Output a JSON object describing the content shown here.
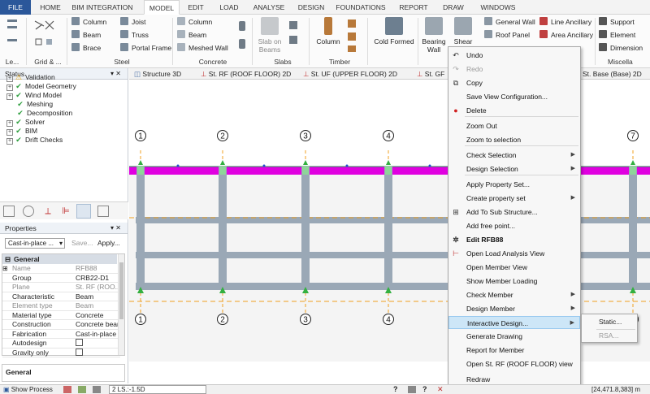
{
  "ribbon_tabs": [
    "FILE",
    "HOME",
    "BIM INTEGRATION",
    "MODEL",
    "EDIT",
    "LOAD",
    "ANALYSE",
    "DESIGN",
    "FOUNDATIONS",
    "REPORT",
    "DRAW",
    "WINDOWS"
  ],
  "ribbon": {
    "levels_label": "Le...",
    "grid_label": "Grid & ...",
    "steel": {
      "column": "Column",
      "beam": "Beam",
      "brace": "Brace",
      "joist": "Joist",
      "truss": "Truss",
      "portal_frame": "Portal Frame",
      "group": "Steel"
    },
    "concrete": {
      "column": "Column",
      "beam": "Beam",
      "meshed_wall": "Meshed Wall",
      "group": "Concrete"
    },
    "slabs": {
      "slab_on_beams": "Slab on Beams",
      "group": "Slabs"
    },
    "timber": {
      "column": "Column",
      "group": "Timber"
    },
    "cold_formed": {
      "label": "Cold Formed"
    },
    "bearing_wall": "Bearing Wall",
    "shear": "Shear",
    "general_wall": "General Wall",
    "roof_panel": "Roof Panel",
    "line_ancillary": "Line Ancillary",
    "area_ancillary": "Area Ancillary",
    "support": "Support",
    "element": "Element",
    "dimension": "Dimension",
    "misc_group": "Miscella"
  },
  "status_panel": {
    "title": "Status",
    "items": [
      {
        "label": "Validation",
        "icon": "warning-icon",
        "state": "warning"
      },
      {
        "label": "Model Geometry",
        "icon": "check-icon",
        "state": "ok"
      },
      {
        "label": "Wind Model",
        "icon": "check-icon",
        "state": "ok"
      },
      {
        "label": "Meshing",
        "icon": "check-icon",
        "state": "ok"
      },
      {
        "label": "Decomposition",
        "icon": "check-icon",
        "state": "ok"
      },
      {
        "label": "Solver",
        "icon": "check-icon",
        "state": "ok"
      },
      {
        "label": "BIM",
        "icon": "check-icon",
        "state": "ok"
      },
      {
        "label": "Drift Checks",
        "icon": "check-icon",
        "state": "ok"
      }
    ]
  },
  "properties_panel": {
    "title": "Properties",
    "selector_value": "Cast-in-place ...",
    "save_label": "Save...",
    "apply_label": "Apply...",
    "section": "General",
    "rows": [
      {
        "key": "Name",
        "value": "RFB88",
        "muted": true
      },
      {
        "key": "Group",
        "value": "CRB22-D1",
        "muted": false
      },
      {
        "key": "Plane",
        "value": "St. RF (ROO...",
        "muted": true
      },
      {
        "key": "Characteristic",
        "value": "Beam",
        "muted": false
      },
      {
        "key": "Element type",
        "value": "Beam",
        "muted": true
      },
      {
        "key": "Material type",
        "value": "Concrete",
        "muted": false
      },
      {
        "key": "Construction",
        "value": "Concrete beam",
        "muted": false
      },
      {
        "key": "Fabrication",
        "value": "Cast-in-place",
        "muted": false
      },
      {
        "key": "Autodesign",
        "value": "",
        "muted": false
      },
      {
        "key": "Gravity only",
        "value": "",
        "muted": false
      }
    ],
    "footer": "General"
  },
  "view_tabs": [
    "Structure 3D",
    "St. RF (ROOF FLOOR) 2D",
    "St. UF (UPPER FLOOR) 2D",
    "St. GF (GR...",
    "St. Base (Base) 2D"
  ],
  "grid_labels": [
    "1",
    "2",
    "3",
    "4",
    "7"
  ],
  "context_menu": {
    "items": [
      {
        "label": "Undo",
        "icon": "undo-icon",
        "disabled": false
      },
      {
        "label": "Redo",
        "icon": "redo-icon",
        "disabled": true
      },
      {
        "label": "Copy",
        "icon": "copy-icon",
        "disabled": false
      },
      {
        "label": "Save View Configuration...",
        "disabled": false
      },
      {
        "label": "Delete",
        "icon": "delete-icon",
        "disabled": false
      },
      {
        "label": "Zoom Out",
        "disabled": false
      },
      {
        "label": "Zoom to selection",
        "disabled": false
      },
      {
        "label": "Check Selection",
        "submenu": true
      },
      {
        "label": "Design Selection",
        "submenu": true
      },
      {
        "label": "Apply Property Set...",
        "disabled": false
      },
      {
        "label": "Create property set",
        "submenu": true
      },
      {
        "label": "Add To Sub Structure...",
        "icon": "substructure-icon"
      },
      {
        "label": "Add free point..."
      },
      {
        "label": "Edit RFB88",
        "icon": "gear-icon",
        "bold": true
      },
      {
        "label": "Open Load Analysis View",
        "icon": "load-icon"
      },
      {
        "label": "Open Member View"
      },
      {
        "label": "Show Member Loading"
      },
      {
        "label": "Check Member",
        "submenu": true
      },
      {
        "label": "Design Member",
        "submenu": true
      },
      {
        "label": "Interactive Design...",
        "submenu": true,
        "highlighted": true
      },
      {
        "label": "Generate Drawing"
      },
      {
        "label": "Report for Member"
      },
      {
        "label": "Open St. RF (ROOF FLOOR) view"
      },
      {
        "label": "Redraw"
      },
      {
        "label": "Save Screenshot"
      }
    ]
  },
  "submenu": {
    "static": "Static...",
    "rsa": "RSA..."
  },
  "status_bar": {
    "show_process": "Show Process",
    "load_combo": "2 LS.:-1.5D",
    "coords": "[24,471.8,383] m"
  },
  "colors": {
    "file_tab": "#2b579a",
    "slab_magenta": "#e000e0",
    "column_gray": "#9aa8b6",
    "menu_highlight": "#cde6f7",
    "dash_orange": "#f0a020",
    "support_green": "#33b040"
  }
}
